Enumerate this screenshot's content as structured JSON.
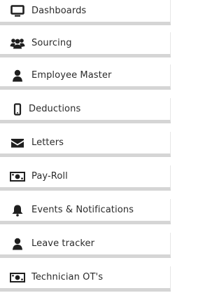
{
  "sidebar": {
    "items": [
      {
        "label": "Dashboards",
        "icon": "monitor-icon"
      },
      {
        "label": "Sourcing",
        "icon": "users-icon"
      },
      {
        "label": "Employee Master",
        "icon": "user-icon"
      },
      {
        "label": "Deductions",
        "icon": "mobile-icon"
      },
      {
        "label": "Letters",
        "icon": "envelope-icon"
      },
      {
        "label": "Pay-Roll",
        "icon": "money-icon"
      },
      {
        "label": "Events & Notifications",
        "icon": "bell-icon"
      },
      {
        "label": "Leave tracker",
        "icon": "user-icon"
      },
      {
        "label": "Technician OT's",
        "icon": "money-icon"
      }
    ],
    "colors": {
      "text": "#2b2b2b",
      "icon": "#1f1f1f",
      "separator": "#d5d5d5"
    }
  }
}
